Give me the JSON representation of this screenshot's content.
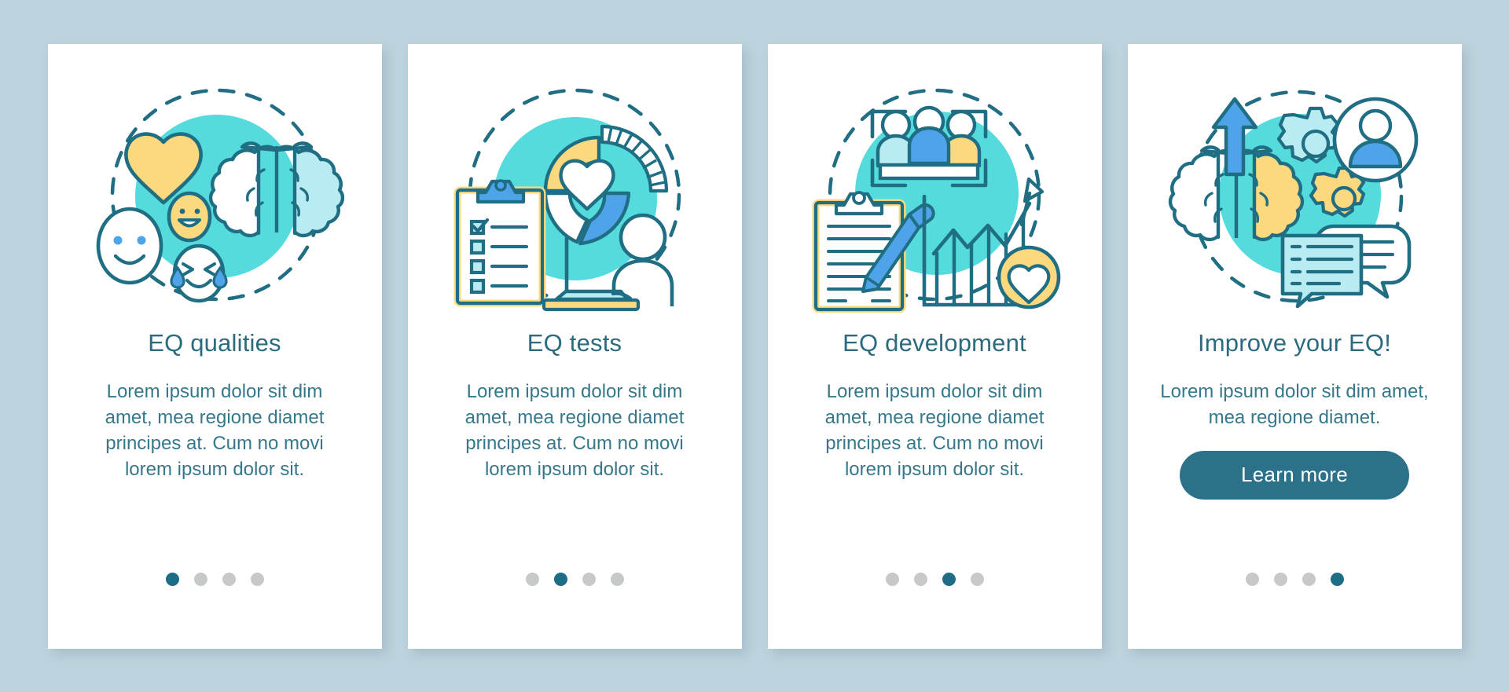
{
  "page": {
    "background_color": "#bdd3dd",
    "card_color": "#ffffff",
    "accent_color": "#2a7189",
    "title_color": "#2b6b7e",
    "body_color": "#36788a",
    "dot_active_color": "#1d6d87",
    "dot_inactive_color": "#c6c8c9",
    "palette": {
      "teal_stroke": "#1f6e83",
      "turquoise": "#55dbdd",
      "light_blue": "#b9ecf2",
      "yellow": "#fcd87f",
      "blue": "#4fa3e8",
      "white": "#ffffff"
    }
  },
  "cards": [
    {
      "id": "eq-qualities",
      "title": "EQ qualities",
      "body": "Lorem ipsum dolor sit dim amet, mea regione diamet principes at. Cum no movi lorem ipsum dolor sit.",
      "illustration": "brain-heart-emoji-faces",
      "dots": {
        "count": 4,
        "active_index": 0
      },
      "has_button": false
    },
    {
      "id": "eq-tests",
      "title": "EQ tests",
      "body": "Lorem ipsum dolor sit dim amet, mea regione diamet principes at. Cum no movi lorem ipsum dolor sit.",
      "illustration": "donut-chart-clipboard-person-laptop",
      "dots": {
        "count": 4,
        "active_index": 1
      },
      "has_button": false
    },
    {
      "id": "eq-development",
      "title": "EQ development",
      "body": "Lorem ipsum dolor sit dim amet, mea regione diamet principes at. Cum no movi lorem ipsum dolor sit.",
      "illustration": "team-meeting-clipboard-growth-chart",
      "dots": {
        "count": 4,
        "active_index": 2
      },
      "has_button": false
    },
    {
      "id": "improve-your-eq",
      "title": "Improve your EQ!",
      "body": "Lorem ipsum dolor sit dim amet, mea regione diamet.",
      "illustration": "brain-arrow-gears-avatar-chat",
      "dots": {
        "count": 4,
        "active_index": 3
      },
      "has_button": true,
      "button_label": "Learn more"
    }
  ]
}
